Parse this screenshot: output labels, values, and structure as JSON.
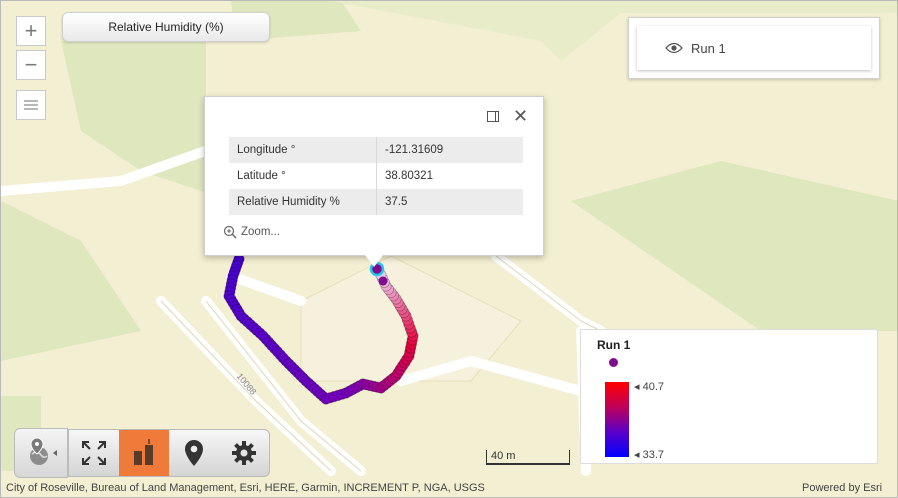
{
  "map": {
    "road_label": "10088",
    "attribution": "City of Roseville, Bureau of Land Management, Esri, HERE, Garmin, INCREMENT P, NGA, USGS",
    "powered_by": "Powered by Esri",
    "scale_label": "40 m"
  },
  "zoom_controls": {
    "zoom_in": "+",
    "zoom_out": "−",
    "layers_icon": "list-icon"
  },
  "layer_title": "Relative Humidity (%)",
  "runs_panel": {
    "items": [
      {
        "label": "Run 1",
        "icon": "eye-icon"
      }
    ]
  },
  "popup": {
    "rows": [
      {
        "key": "Longitude °",
        "value": "-121.31609"
      },
      {
        "key": "Latitude °",
        "value": "38.80321"
      },
      {
        "key": "Relative Humidity %",
        "value": "37.5"
      }
    ],
    "zoom_label": "Zoom...",
    "icons": [
      "dock-icon",
      "close-icon",
      "zoom-icon"
    ]
  },
  "legend": {
    "title": "Run 1",
    "max": "40.7",
    "min": "33.7",
    "colors": {
      "high": "#ff0000",
      "low": "#0000ff",
      "dot": "#7d0d8e"
    }
  },
  "toolbar": {
    "icons": [
      "globe-pin-icon",
      "fullscreen-icon",
      "bar-chart-icon",
      "location-pin-icon",
      "gear-icon"
    ],
    "active": "bar-chart-icon",
    "accent": "#f07a3a"
  }
}
